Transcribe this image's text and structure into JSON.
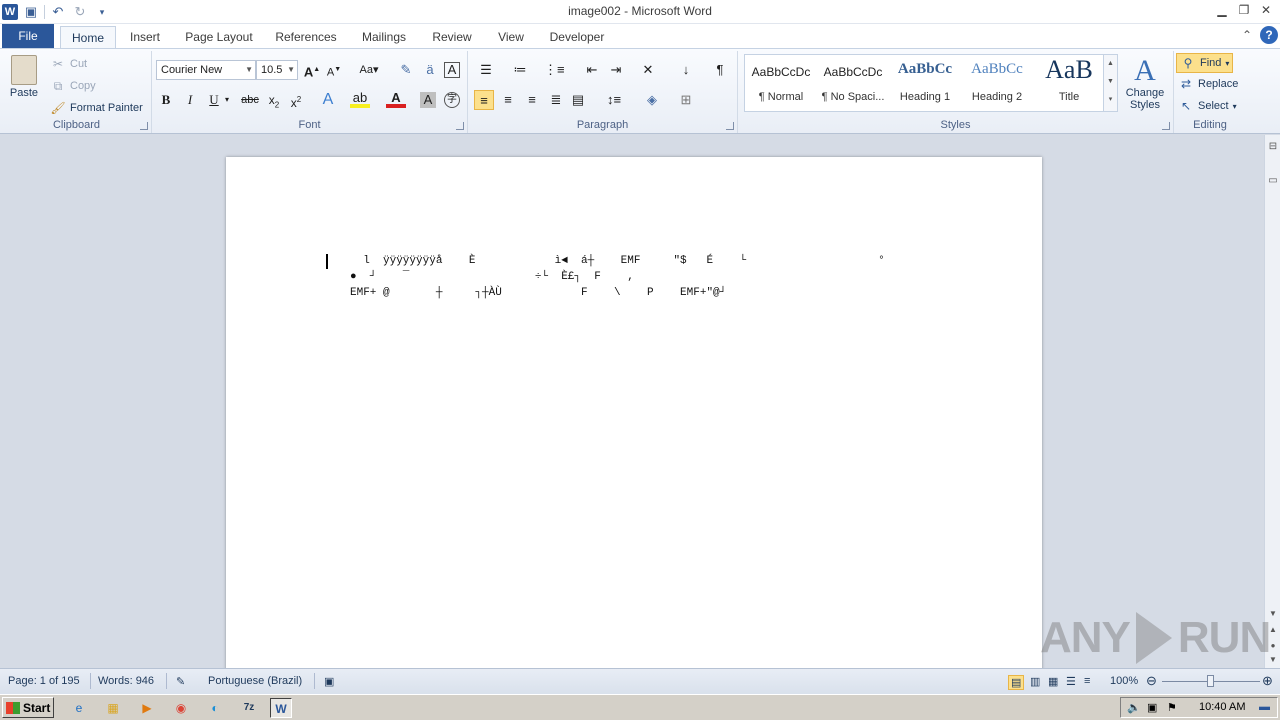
{
  "window": {
    "title": "image002 - Microsoft Word"
  },
  "qat": {
    "icons": [
      "word-logo",
      "save-icon",
      "undo-icon",
      "redo-icon",
      "customize-qat-icon"
    ]
  },
  "tabs": [
    "File",
    "Home",
    "Insert",
    "Page Layout",
    "References",
    "Mailings",
    "Review",
    "View",
    "Developer"
  ],
  "clipboard": {
    "paste": "Paste",
    "cut": "Cut",
    "copy": "Copy",
    "format_painter": "Format Painter",
    "label": "Clipboard"
  },
  "font": {
    "name": "Courier New",
    "size": "10.5",
    "label": "Font"
  },
  "paragraph": {
    "label": "Paragraph"
  },
  "styles": {
    "items": [
      {
        "sample": "AaBbCcDc",
        "name": "¶ Normal"
      },
      {
        "sample": "AaBbCcDc",
        "name": "¶ No Spaci..."
      },
      {
        "sample": "AaBbCc",
        "name": "Heading 1"
      },
      {
        "sample": "AaBbCc",
        "name": "Heading 2"
      },
      {
        "sample": "AaB",
        "name": "Title"
      }
    ],
    "change_styles": "Change Styles",
    "label": "Styles"
  },
  "editing": {
    "find": "Find",
    "replace": "Replace",
    "select": "Select",
    "label": "Editing"
  },
  "document": {
    "lines": [
      "  l  ÿÿÿÿÿÿÿÿå    È            ì◄  á┼    EMF     ″$   É    └                    °",
      "●  ┘    ¯                   ÷└  È£┐  F    ,",
      "EMF+ @       ┼     ┐┼ÀÙ            F    \\    P    EMF+″@┘"
    ]
  },
  "statusbar": {
    "page": "Page: 1 of 195",
    "words": "Words: 946",
    "language": "Portuguese (Brazil)",
    "zoom": "100%"
  },
  "taskbar": {
    "start": "Start",
    "time": "10:40 AM"
  },
  "watermark": {
    "text_left": "ANY",
    "text_right": "RUN"
  }
}
